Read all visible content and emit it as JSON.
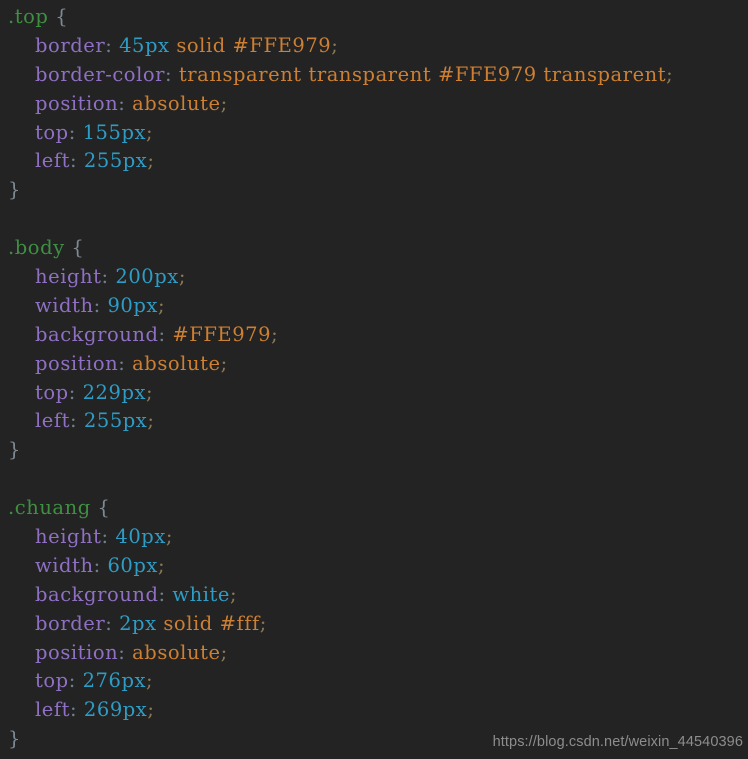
{
  "editor": {
    "background_color": "#232323",
    "palette": {
      "selector": "#3f8f43",
      "property": "#9070c4",
      "number": "#2e9dc6",
      "keyword": "#2e9dc6",
      "string": "#cd7f32",
      "punctuation": "#6f7f8c",
      "brace": "#7d8a93",
      "semicolon": "#8a7a55"
    },
    "lines": [
      {
        "indent": 0,
        "tokens": [
          {
            "t": ".top",
            "k": "selector"
          },
          {
            "t": " ",
            "k": "plain"
          },
          {
            "t": "{",
            "k": "brace"
          }
        ]
      },
      {
        "indent": 0,
        "tokens": [
          {
            "t": "    ",
            "k": "plain"
          },
          {
            "t": "border",
            "k": "prop"
          },
          {
            "t": ":",
            "k": "punc"
          },
          {
            "t": " ",
            "k": "plain"
          },
          {
            "t": "45px",
            "k": "num"
          },
          {
            "t": " ",
            "k": "plain"
          },
          {
            "t": "solid",
            "k": "str"
          },
          {
            "t": " ",
            "k": "plain"
          },
          {
            "t": "#FFE979",
            "k": "hex"
          },
          {
            "t": ";",
            "k": "semi"
          }
        ]
      },
      {
        "indent": 0,
        "tokens": [
          {
            "t": "    ",
            "k": "plain"
          },
          {
            "t": "border-color",
            "k": "prop"
          },
          {
            "t": ":",
            "k": "punc"
          },
          {
            "t": " ",
            "k": "plain"
          },
          {
            "t": "transparent",
            "k": "str"
          },
          {
            "t": " ",
            "k": "plain"
          },
          {
            "t": "transparent",
            "k": "str"
          },
          {
            "t": " ",
            "k": "plain"
          },
          {
            "t": "#FFE979",
            "k": "hex"
          },
          {
            "t": " ",
            "k": "plain"
          },
          {
            "t": "transparent",
            "k": "str"
          },
          {
            "t": ";",
            "k": "semi"
          }
        ]
      },
      {
        "indent": 0,
        "tokens": [
          {
            "t": "    ",
            "k": "plain"
          },
          {
            "t": "position",
            "k": "prop"
          },
          {
            "t": ":",
            "k": "punc"
          },
          {
            "t": " ",
            "k": "plain"
          },
          {
            "t": "absolute",
            "k": "str"
          },
          {
            "t": ";",
            "k": "semi"
          }
        ]
      },
      {
        "indent": 0,
        "tokens": [
          {
            "t": "    ",
            "k": "plain"
          },
          {
            "t": "top",
            "k": "prop"
          },
          {
            "t": ":",
            "k": "punc"
          },
          {
            "t": " ",
            "k": "plain"
          },
          {
            "t": "155px",
            "k": "num"
          },
          {
            "t": ";",
            "k": "semi"
          }
        ]
      },
      {
        "indent": 0,
        "tokens": [
          {
            "t": "    ",
            "k": "plain"
          },
          {
            "t": "left",
            "k": "prop"
          },
          {
            "t": ":",
            "k": "punc"
          },
          {
            "t": " ",
            "k": "plain"
          },
          {
            "t": "255px",
            "k": "num"
          },
          {
            "t": ";",
            "k": "semi"
          }
        ]
      },
      {
        "indent": 0,
        "tokens": [
          {
            "t": "}",
            "k": "brace"
          }
        ]
      },
      {
        "indent": 0,
        "tokens": []
      },
      {
        "indent": 0,
        "tokens": [
          {
            "t": ".body",
            "k": "selector"
          },
          {
            "t": " ",
            "k": "plain"
          },
          {
            "t": "{",
            "k": "brace"
          }
        ]
      },
      {
        "indent": 0,
        "tokens": [
          {
            "t": "    ",
            "k": "plain"
          },
          {
            "t": "height",
            "k": "prop"
          },
          {
            "t": ":",
            "k": "punc"
          },
          {
            "t": " ",
            "k": "plain"
          },
          {
            "t": "200px",
            "k": "num"
          },
          {
            "t": ";",
            "k": "semi"
          }
        ]
      },
      {
        "indent": 0,
        "tokens": [
          {
            "t": "    ",
            "k": "plain"
          },
          {
            "t": "width",
            "k": "prop"
          },
          {
            "t": ":",
            "k": "punc"
          },
          {
            "t": " ",
            "k": "plain"
          },
          {
            "t": "90px",
            "k": "num"
          },
          {
            "t": ";",
            "k": "semi"
          }
        ]
      },
      {
        "indent": 0,
        "tokens": [
          {
            "t": "    ",
            "k": "plain"
          },
          {
            "t": "background",
            "k": "prop"
          },
          {
            "t": ":",
            "k": "punc"
          },
          {
            "t": " ",
            "k": "plain"
          },
          {
            "t": "#FFE979",
            "k": "hex"
          },
          {
            "t": ";",
            "k": "semi"
          }
        ]
      },
      {
        "indent": 0,
        "tokens": [
          {
            "t": "    ",
            "k": "plain"
          },
          {
            "t": "position",
            "k": "prop"
          },
          {
            "t": ":",
            "k": "punc"
          },
          {
            "t": " ",
            "k": "plain"
          },
          {
            "t": "absolute",
            "k": "str"
          },
          {
            "t": ";",
            "k": "semi"
          }
        ]
      },
      {
        "indent": 0,
        "tokens": [
          {
            "t": "    ",
            "k": "plain"
          },
          {
            "t": "top",
            "k": "prop"
          },
          {
            "t": ":",
            "k": "punc"
          },
          {
            "t": " ",
            "k": "plain"
          },
          {
            "t": "229px",
            "k": "num"
          },
          {
            "t": ";",
            "k": "semi"
          }
        ]
      },
      {
        "indent": 0,
        "tokens": [
          {
            "t": "    ",
            "k": "plain"
          },
          {
            "t": "left",
            "k": "prop"
          },
          {
            "t": ":",
            "k": "punc"
          },
          {
            "t": " ",
            "k": "plain"
          },
          {
            "t": "255px",
            "k": "num"
          },
          {
            "t": ";",
            "k": "semi"
          }
        ]
      },
      {
        "indent": 0,
        "tokens": [
          {
            "t": "}",
            "k": "brace"
          }
        ]
      },
      {
        "indent": 0,
        "tokens": []
      },
      {
        "indent": 0,
        "tokens": [
          {
            "t": ".chuang",
            "k": "selector"
          },
          {
            "t": " ",
            "k": "plain"
          },
          {
            "t": "{",
            "k": "brace"
          }
        ]
      },
      {
        "indent": 0,
        "tokens": [
          {
            "t": "    ",
            "k": "plain"
          },
          {
            "t": "height",
            "k": "prop"
          },
          {
            "t": ":",
            "k": "punc"
          },
          {
            "t": " ",
            "k": "plain"
          },
          {
            "t": "40px",
            "k": "num"
          },
          {
            "t": ";",
            "k": "semi"
          }
        ]
      },
      {
        "indent": 0,
        "tokens": [
          {
            "t": "    ",
            "k": "plain"
          },
          {
            "t": "width",
            "k": "prop"
          },
          {
            "t": ":",
            "k": "punc"
          },
          {
            "t": " ",
            "k": "plain"
          },
          {
            "t": "60px",
            "k": "num"
          },
          {
            "t": ";",
            "k": "semi"
          }
        ]
      },
      {
        "indent": 0,
        "tokens": [
          {
            "t": "    ",
            "k": "plain"
          },
          {
            "t": "background",
            "k": "prop"
          },
          {
            "t": ":",
            "k": "punc"
          },
          {
            "t": " ",
            "k": "plain"
          },
          {
            "t": "white",
            "k": "kw"
          },
          {
            "t": ";",
            "k": "semi"
          }
        ]
      },
      {
        "indent": 0,
        "tokens": [
          {
            "t": "    ",
            "k": "plain"
          },
          {
            "t": "border",
            "k": "prop"
          },
          {
            "t": ":",
            "k": "punc"
          },
          {
            "t": " ",
            "k": "plain"
          },
          {
            "t": "2px",
            "k": "num"
          },
          {
            "t": " ",
            "k": "plain"
          },
          {
            "t": "solid",
            "k": "str"
          },
          {
            "t": " ",
            "k": "plain"
          },
          {
            "t": "#fff",
            "k": "hex"
          },
          {
            "t": ";",
            "k": "semi"
          }
        ]
      },
      {
        "indent": 0,
        "tokens": [
          {
            "t": "    ",
            "k": "plain"
          },
          {
            "t": "position",
            "k": "prop"
          },
          {
            "t": ":",
            "k": "punc"
          },
          {
            "t": " ",
            "k": "plain"
          },
          {
            "t": "absolute",
            "k": "str"
          },
          {
            "t": ";",
            "k": "semi"
          }
        ]
      },
      {
        "indent": 0,
        "tokens": [
          {
            "t": "    ",
            "k": "plain"
          },
          {
            "t": "top",
            "k": "prop"
          },
          {
            "t": ":",
            "k": "punc"
          },
          {
            "t": " ",
            "k": "plain"
          },
          {
            "t": "276px",
            "k": "num"
          },
          {
            "t": ";",
            "k": "semi"
          }
        ]
      },
      {
        "indent": 0,
        "tokens": [
          {
            "t": "    ",
            "k": "plain"
          },
          {
            "t": "left",
            "k": "prop"
          },
          {
            "t": ":",
            "k": "punc"
          },
          {
            "t": " ",
            "k": "plain"
          },
          {
            "t": "269px",
            "k": "num"
          },
          {
            "t": ";",
            "k": "semi"
          }
        ]
      },
      {
        "indent": 0,
        "tokens": [
          {
            "t": "}",
            "k": "brace"
          }
        ]
      }
    ]
  },
  "watermark": {
    "text": "https://blog.csdn.net/weixin_44540396"
  }
}
